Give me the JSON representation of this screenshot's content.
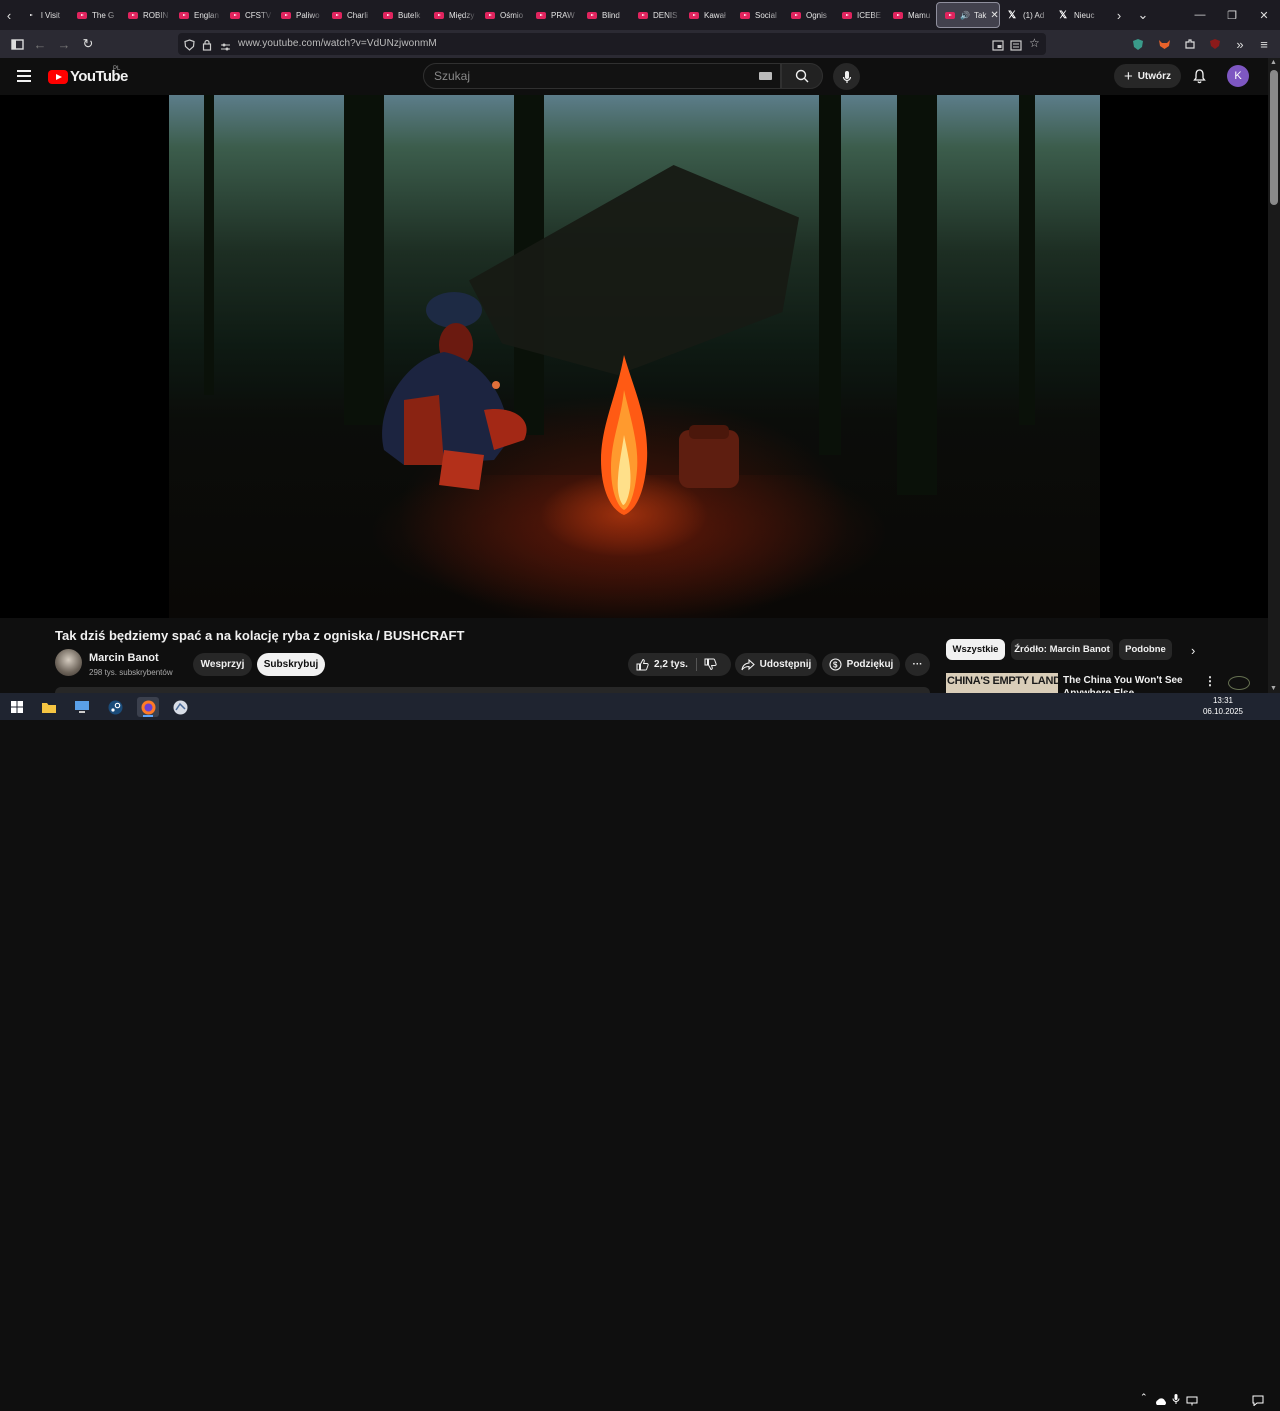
{
  "browser": {
    "tabs": [
      {
        "label": "l Visit",
        "icon": "tab-icon"
      },
      {
        "label": "The G",
        "icon": "youtube-icon"
      },
      {
        "label": "ROBIN",
        "icon": "youtube-icon"
      },
      {
        "label": "Englan",
        "icon": "youtube-icon"
      },
      {
        "label": "CFSTV",
        "icon": "youtube-icon"
      },
      {
        "label": "Paliwo",
        "icon": "youtube-icon"
      },
      {
        "label": "Charli",
        "icon": "youtube-icon"
      },
      {
        "label": "Butelk",
        "icon": "youtube-icon"
      },
      {
        "label": "Między",
        "icon": "youtube-icon"
      },
      {
        "label": "Ośmio",
        "icon": "youtube-icon"
      },
      {
        "label": "PRAW",
        "icon": "youtube-icon"
      },
      {
        "label": "Blind",
        "icon": "youtube-icon"
      },
      {
        "label": "DENIS",
        "icon": "youtube-icon"
      },
      {
        "label": "Kawał",
        "icon": "youtube-icon"
      },
      {
        "label": "Social",
        "icon": "youtube-icon"
      },
      {
        "label": "Ognis",
        "icon": "youtube-icon"
      },
      {
        "label": "ICEBE",
        "icon": "youtube-icon"
      },
      {
        "label": "Mamu",
        "icon": "youtube-icon"
      },
      {
        "label": "Tak",
        "icon": "youtube-icon",
        "active": true
      },
      {
        "label": "(1) Ad",
        "icon": "x-icon"
      },
      {
        "label": "Nieuc",
        "icon": "x-icon"
      }
    ],
    "url": "www.youtube.com/watch?v=VdUNzjwonmM",
    "extensions_badge": "104"
  },
  "youtube": {
    "logo_text": "YouTube",
    "country_code": "PL",
    "search_placeholder": "Szukaj",
    "create_label": "Utwórz",
    "avatar_letter": "K"
  },
  "video": {
    "title": "Tak dziś będziemy spać a na kolację ryba z ogniska / BUSHCRAFT",
    "channel_name": "Marcin Banot",
    "subscribers": "298 tys. subskrybentów",
    "support_label": "Wesprzyj",
    "subscribe_label": "Subskrybuj",
    "likes": "2,2 tys.",
    "share_label": "Udostępnij",
    "thanks_label": "Podziękuj"
  },
  "sidebar": {
    "chips": [
      "Wszystkie",
      "Źródło: Marcin Banot",
      "Podobne"
    ],
    "recommendation": {
      "thumb_text": "CHINA'S EMPTY LANDS",
      "title": "The China You Won't See Anywhere Else"
    }
  },
  "taskbar": {
    "time": "13:31",
    "date": "06.10.2025"
  },
  "colors": {
    "youtube_red": "#ff0000",
    "avatar_purple": "#7e57c2",
    "tab_favicon": "#e0245e"
  }
}
